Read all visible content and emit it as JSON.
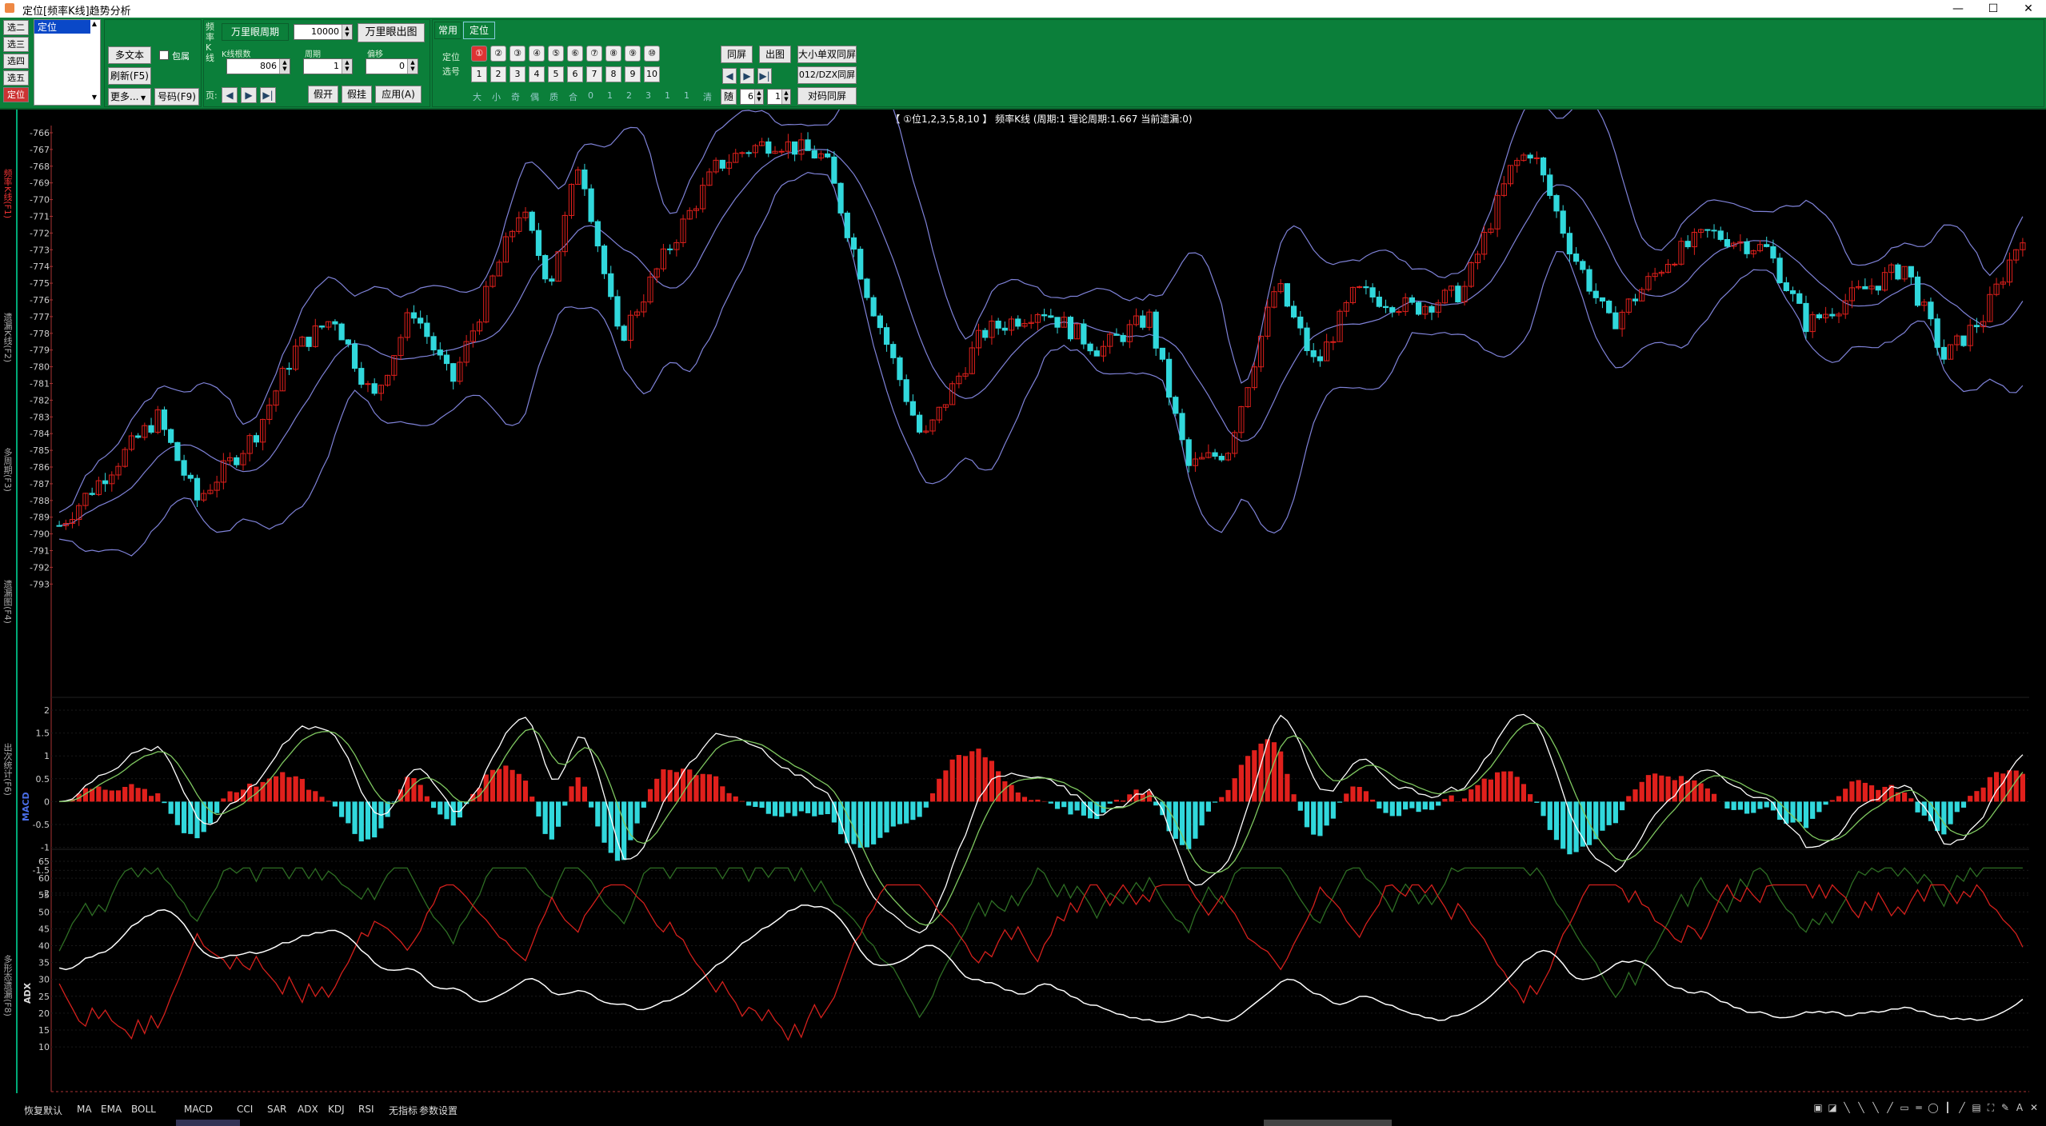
{
  "window": {
    "title": "定位[频率K线]趋势分析",
    "min": "—",
    "max": "☐",
    "close": "✕"
  },
  "toolbar": {
    "left_tabs": [
      "选二",
      "选三",
      "选四",
      "选五",
      "定位"
    ],
    "list_selected": "定位",
    "multi_text": "多文本",
    "checkbox_label": "包属",
    "refresh": "刷新(F5)",
    "more": "更多...",
    "number_btn": "号码(F9)",
    "vlabel1": "频率K线",
    "wanli_label": "万里眼周期",
    "wanli_value": "10000",
    "wanli_btn": "万里眼出图",
    "kline_label": "K线根数",
    "kline_value": "806",
    "period_label": "周期",
    "period_value": "1",
    "offset_label": "偏移",
    "offset_value": "0",
    "page_label": "页:",
    "fake_open": "假开",
    "fake_hang": "假挂",
    "apply": "应用(A)",
    "tab_common": "常用",
    "tab_locate": "定位",
    "locate_label": "定位",
    "select_label": "选号",
    "circles": [
      "①",
      "②",
      "③",
      "④",
      "⑤",
      "⑥",
      "⑦",
      "⑧",
      "⑨",
      "⑩"
    ],
    "nums": [
      "1",
      "2",
      "3",
      "4",
      "5",
      "6",
      "7",
      "8",
      "9",
      "10"
    ],
    "attrs": [
      "大",
      "小",
      "奇",
      "偶",
      "质",
      "合",
      "0",
      "1",
      "2",
      "3",
      "1",
      "1",
      "清"
    ],
    "same_screen": "同屏",
    "out_chart": "出图",
    "bigsmall": "大小单双同屏",
    "btn012": "012/DZX同屏",
    "random": "随",
    "rand_a": "6",
    "rand_b": "1",
    "duima": "对码同屏"
  },
  "left_tabs": [
    "频率K线(F1)",
    "遗漏K线(F2)",
    "多周期(F3)",
    "遗漏图(F4)",
    "出次统计(F6)",
    "多形态遗漏(F8)"
  ],
  "chart": {
    "title": "【 ①位1,2,3,5,8,10 】 频率K线 (周期:1 理论周期:1.667 当前遗漏:0)",
    "price_ticks": [
      "-766",
      "-767",
      "-768",
      "-769",
      "-770",
      "-771",
      "-772",
      "-773",
      "-774",
      "-775",
      "-776",
      "-777",
      "-778",
      "-779",
      "-780",
      "-781",
      "-782",
      "-783",
      "-784",
      "-785",
      "-786",
      "-787",
      "-788",
      "-789",
      "-790",
      "-791",
      "-792",
      "-793"
    ],
    "macd_label": "MACD",
    "macd_ticks": [
      "2",
      "1.5",
      "1",
      "0.5",
      "0",
      "-0.5",
      "-1",
      "-1.5",
      "-2"
    ],
    "adx_label": "ADX",
    "adx_ticks": [
      "65",
      "60",
      "55",
      "50",
      "45",
      "40",
      "35",
      "30",
      "25",
      "20",
      "15",
      "10"
    ],
    "colors": {
      "up": "#e0201c",
      "down": "#31d8dc",
      "band": "#7f82d8",
      "macd_white": "#ffffff",
      "macd_green": "#7fc860",
      "adx_red": "#d4201c",
      "adx_green": "#2e6e24",
      "adx_white": "#ffffff"
    }
  },
  "bottom": {
    "items": [
      "恢复默认",
      "MA",
      "EMA",
      "BOLL",
      "MACD",
      "CCI",
      "SAR",
      "ADX",
      "KDJ",
      "RSI",
      "无指标",
      "参数设置"
    ]
  }
}
